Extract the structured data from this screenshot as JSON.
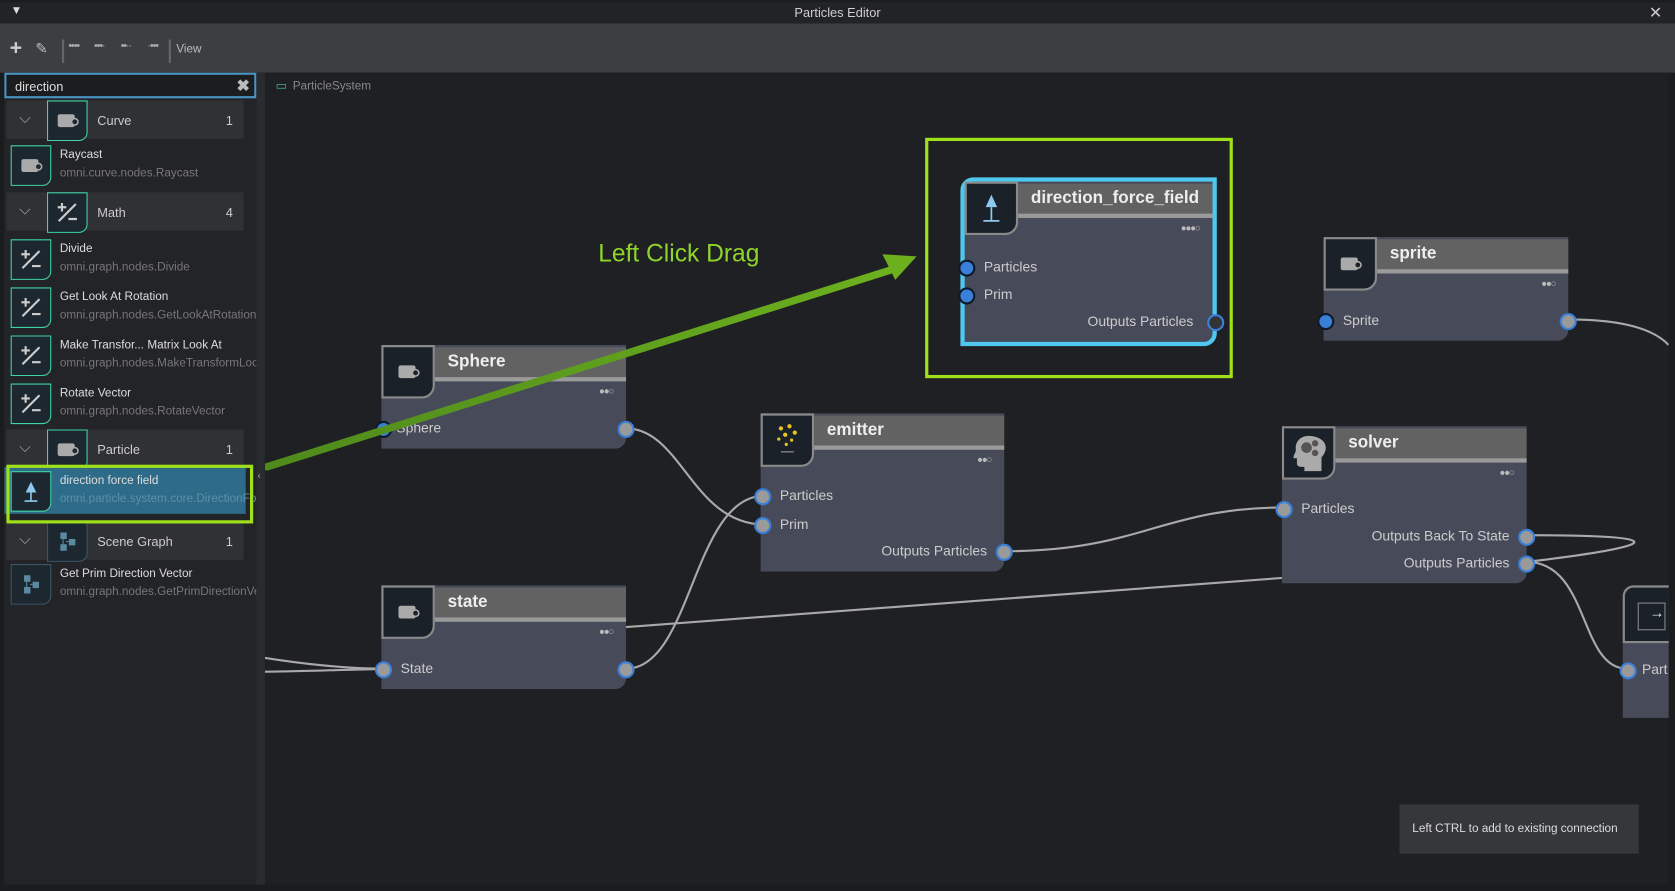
{
  "window": {
    "title": "Particles Editor",
    "close_icon": "close-icon",
    "menu_icon": "triangle-down-icon"
  },
  "toolbar": {
    "add_icon": "plus-icon",
    "edit_icon": "pencil-icon",
    "view_label": "View"
  },
  "search": {
    "value": "direction",
    "clear_icon": "x-icon"
  },
  "sidebar": {
    "categories": [
      {
        "label": "Curve",
        "count": "1",
        "items": [
          {
            "name": "Raycast",
            "path": "omni.curve.nodes.Raycast"
          }
        ]
      },
      {
        "label": "Math",
        "count": "4",
        "items": [
          {
            "name": "Divide",
            "path": "omni.graph.nodes.Divide"
          },
          {
            "name": "Get Look At Rotation",
            "path": "omni.graph.nodes.GetLookAtRotation"
          },
          {
            "name": "Make Transfor... Matrix Look At",
            "path": "omni.graph.nodes.MakeTransformLookAt"
          },
          {
            "name": "Rotate Vector",
            "path": "omni.graph.nodes.RotateVector"
          }
        ]
      },
      {
        "label": "Particle",
        "count": "1",
        "items": [
          {
            "name": "direction force field",
            "path": "omni.particle.system.core.DirectionForceField",
            "selected": true
          }
        ]
      },
      {
        "label": "Scene Graph",
        "count": "1",
        "items": [
          {
            "name": "Get Prim Direction Vector",
            "path": "omni.graph.nodes.GetPrimDirectionVector"
          }
        ]
      }
    ]
  },
  "canvas": {
    "breadcrumb": "ParticleSystem",
    "annotation": "Left Click Drag",
    "annotation_color": "#8fd42a",
    "highlight_color": "#9fe01b",
    "tooltip": "Left CTRL to add to existing connection",
    "nodes": {
      "sphere": {
        "title": "Sphere",
        "ports": [
          "Sphere"
        ]
      },
      "state": {
        "title": "state",
        "ports": [
          "State"
        ]
      },
      "emitter": {
        "title": "emitter",
        "inputs": [
          "Particles",
          "Prim"
        ],
        "outputs": [
          "Outputs Particles"
        ]
      },
      "dff": {
        "title": "direction_force_field",
        "inputs": [
          "Particles",
          "Prim"
        ],
        "outputs": [
          "Outputs Particles"
        ]
      },
      "sprite": {
        "title": "sprite",
        "ports": [
          "Sprite"
        ]
      },
      "solver": {
        "title": "solver",
        "inputs": [
          "Particles"
        ],
        "outputs": [
          "Outputs Back To State",
          "Outputs Particles"
        ]
      },
      "output": {
        "inputs": [
          "Part"
        ]
      }
    }
  }
}
